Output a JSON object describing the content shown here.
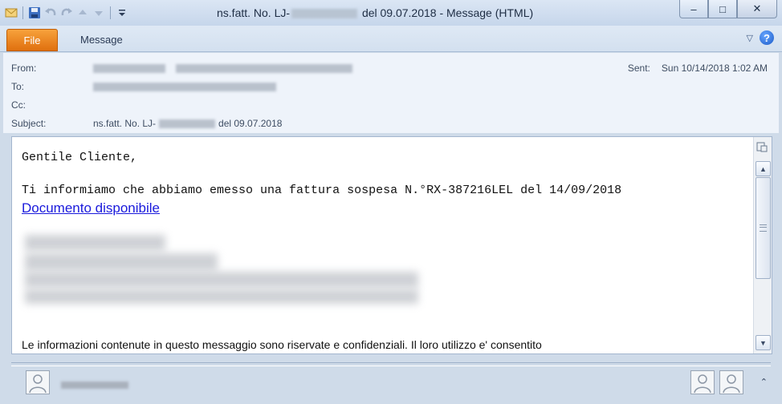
{
  "window": {
    "title_prefix": "ns.fatt. No. LJ-",
    "title_suffix": "del 09.07.2018  -  Message (HTML)",
    "controls": {
      "minimize": "–",
      "maximize": "□",
      "close": "✕"
    }
  },
  "qat": {
    "icons": [
      "mail-icon",
      "save-icon",
      "undo-icon",
      "redo-icon",
      "up-icon",
      "down-icon",
      "customize-icon"
    ]
  },
  "ribbon": {
    "file_tab": "File",
    "message_tab": "Message",
    "minimize_ribbon": "▽",
    "help": "?"
  },
  "header": {
    "from_label": "From:",
    "to_label": "To:",
    "cc_label": "Cc:",
    "subject_label": "Subject:",
    "subject_prefix": "ns.fatt. No. LJ-",
    "subject_suffix": "del 09.07.2018",
    "sent_label": "Sent:",
    "sent_value": "Sun 10/14/2018 1:02 AM"
  },
  "body": {
    "greeting": "Gentile Cliente,",
    "info_line": "Ti informiamo che abbiamo emesso una fattura sospesa N.°RX-387216LEL del 14/09/2018",
    "link_text": "Documento disponibile",
    "disclaimer": "Le informazioni contenute in questo messaggio sono riservate e confidenziali. Il loro utilizzo e' consentito"
  },
  "scrollbar": {
    "up": "▲",
    "down": "▼"
  },
  "footer": {
    "collapse": "⌃"
  },
  "colors": {
    "file_tab": "#e9780f",
    "link": "#1a1adc",
    "background": "#cfdbe9"
  }
}
